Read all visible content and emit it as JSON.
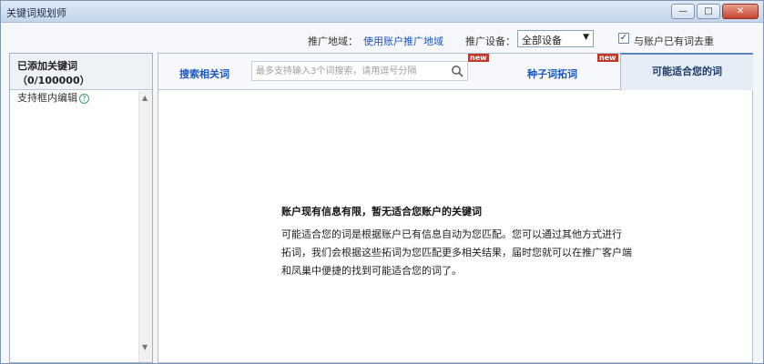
{
  "window": {
    "title": "关键词规划师",
    "controls": {
      "minimize": "—",
      "maximize": "□",
      "close": "✕"
    }
  },
  "topbar": {
    "region_label": "推广地域：",
    "region_link": "使用账户推广地域",
    "device_label": "推广设备：",
    "device_value": "全部设备",
    "dedupe_checked": true,
    "dedupe_label": "与账户已有词去重"
  },
  "sidebar": {
    "title": "已添加关键词（0/100000）",
    "subtitle": "支持框内编辑"
  },
  "tabs": {
    "search_label": "搜索相关词",
    "search_placeholder": "最多支持输入3个词搜索，请用逗号分隔",
    "new_badge": "new",
    "seed_label": "种子词拓词",
    "suggested_label": "可能适合您的词"
  },
  "message": {
    "heading": "账户现有信息有限，暂无适合您账户的关键词",
    "line1": "可能适合您的词是根据账户已有信息自动为您匹配。您可以通过其他方式进行",
    "line2": "拓词，我们会根据这些拓词为您匹配更多相关结果，届时您就可以在推广客户端",
    "line3": "和凤巢中便捷的找到可能适合您的词了。"
  },
  "colors": {
    "link": "#1a56c4",
    "badge": "#c0392b",
    "active_tab": "#e6edf6"
  }
}
